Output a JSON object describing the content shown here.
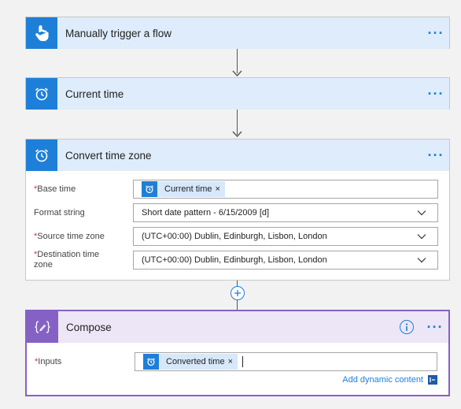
{
  "cards": {
    "trigger": {
      "title": "Manually trigger a flow",
      "icon": "hand-pointer-icon"
    },
    "current_time": {
      "title": "Current time",
      "icon": "alarm-clock-icon"
    },
    "convert": {
      "title": "Convert time zone",
      "icon": "alarm-clock-icon",
      "base_time_label": "Base time",
      "base_time_token": "Current time",
      "format_label": "Format string",
      "format_value": "Short date pattern - 6/15/2009 [d]",
      "source_label": "Source time zone",
      "source_value": "(UTC+00:00) Dublin, Edinburgh, Lisbon, London",
      "dest_label_1": "Destination time",
      "dest_label_2": "zone",
      "dest_value": "(UTC+00:00) Dublin, Edinburgh, Lisbon, London"
    },
    "compose": {
      "title": "Compose",
      "icon": "compose-braces-icon",
      "inputs_label": "Inputs",
      "inputs_token": "Converted time",
      "dynamic_link": "Add dynamic content"
    }
  },
  "common": {
    "more": "···",
    "required_mark": "*",
    "token_close": "×"
  },
  "colors": {
    "accent": "#1e7fd8",
    "header_bg": "#deecfb",
    "compose_accent": "#8661c5",
    "compose_header": "#ece6f7",
    "required": "#d13438"
  }
}
